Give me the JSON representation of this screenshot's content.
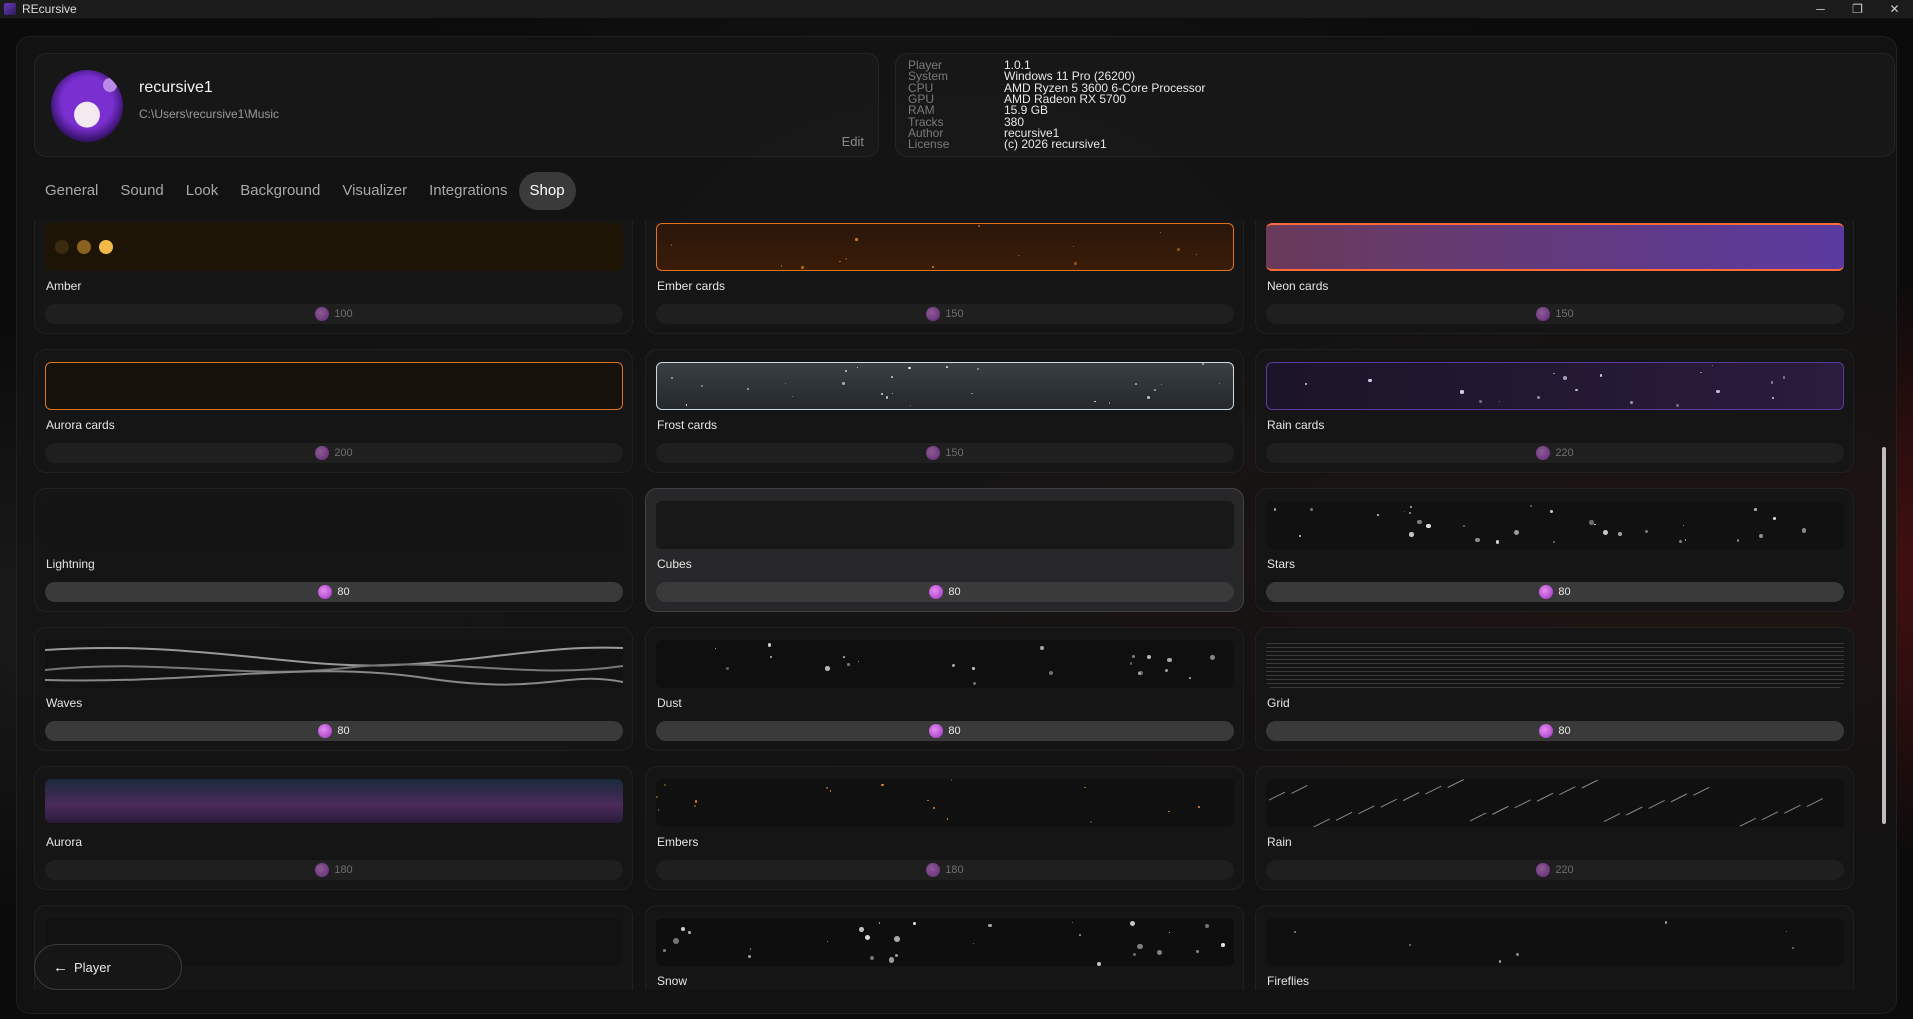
{
  "window": {
    "title": "REcursive",
    "min": "─",
    "max": "❐",
    "close": "✕"
  },
  "profile": {
    "name": "recursive1",
    "path": "C:\\Users\\recursive1\\Music",
    "edit_label": "Edit"
  },
  "sysinfo": [
    {
      "k": "Player",
      "v": "1.0.1"
    },
    {
      "k": "System",
      "v": "Windows 11 Pro (26200)"
    },
    {
      "k": "CPU",
      "v": "AMD Ryzen 5 3600 6-Core Processor"
    },
    {
      "k": "GPU",
      "v": "AMD Radeon RX 5700"
    },
    {
      "k": "RAM",
      "v": "15.9 GB"
    },
    {
      "k": "Tracks",
      "v": "380"
    },
    {
      "k": "Author",
      "v": "recursive1"
    },
    {
      "k": "License",
      "v": "(c) 2026 recursive1"
    }
  ],
  "tabs": [
    "General",
    "Sound",
    "Look",
    "Background",
    "Visualizer",
    "Integrations",
    "Shop"
  ],
  "active_tab": "Shop",
  "items": [
    {
      "name": "Amber",
      "price": "100",
      "buy": false
    },
    {
      "name": "Ember cards",
      "price": "150",
      "buy": false
    },
    {
      "name": "Neon cards",
      "price": "150",
      "buy": false
    },
    {
      "name": "Aurora cards",
      "price": "200",
      "buy": false
    },
    {
      "name": "Frost cards",
      "price": "150",
      "buy": false
    },
    {
      "name": "Rain cards",
      "price": "220",
      "buy": false
    },
    {
      "name": "Lightning",
      "price": "80",
      "buy": true
    },
    {
      "name": "Cubes",
      "price": "80",
      "buy": true
    },
    {
      "name": "Stars",
      "price": "80",
      "buy": true
    },
    {
      "name": "Waves",
      "price": "80",
      "buy": true
    },
    {
      "name": "Dust",
      "price": "80",
      "buy": true
    },
    {
      "name": "Grid",
      "price": "80",
      "buy": true
    },
    {
      "name": "Aurora",
      "price": "180",
      "buy": false
    },
    {
      "name": "Embers",
      "price": "180",
      "buy": false
    },
    {
      "name": "Rain",
      "price": "220",
      "buy": false
    },
    {
      "name": "",
      "price": "",
      "buy": false
    },
    {
      "name": "Snow",
      "price": "",
      "buy": false
    },
    {
      "name": "Fireflies",
      "price": "",
      "buy": false
    }
  ],
  "player_button": {
    "label": "Player"
  },
  "colors": {
    "accent_amber": "#f0b94a",
    "ember": "#e0731e",
    "neon_purple": "#7a4cff",
    "coin": "#c04ad8"
  }
}
